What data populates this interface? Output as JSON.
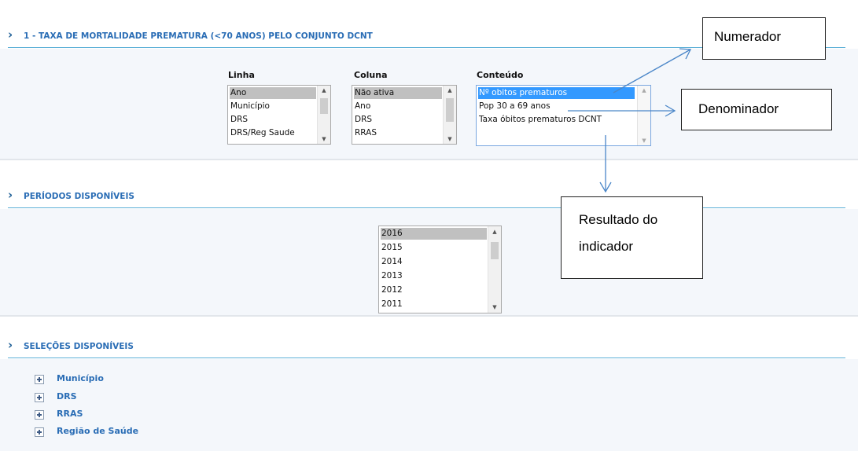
{
  "sections": {
    "taxa": {
      "title": "1 - TAXA DE MORTALIDADE PREMATURA (<70 ANOS) PELO CONJUNTO DCNT"
    },
    "periodos": {
      "title": "PERÍODOS DISPONÍVEIS"
    },
    "selecoes": {
      "title": "SELEÇÕES DISPONÍVEIS"
    }
  },
  "linha": {
    "label": "Linha",
    "items": [
      "Ano",
      "Município",
      "DRS",
      "DRS/Reg Saude"
    ],
    "selected": "Ano"
  },
  "coluna": {
    "label": "Coluna",
    "items": [
      "Não ativa",
      "Ano",
      "DRS",
      "RRAS"
    ],
    "selected": "Não ativa"
  },
  "conteudo": {
    "label": "Conteúdo",
    "items": [
      "Nº obitos prematuros",
      "Pop 30 a 69 anos",
      "Taxa óbitos prematuros DCNT"
    ],
    "selected": "Nº obitos prematuros"
  },
  "periodos_list": {
    "items": [
      "2016",
      "2015",
      "2014",
      "2013",
      "2012",
      "2011"
    ],
    "selected": "2016"
  },
  "selecoes_tree": {
    "items": [
      "Município",
      "DRS",
      "RRAS",
      "Região de Saúde"
    ]
  },
  "callouts": {
    "numerador": "Numerador",
    "denominador": "Denominador",
    "resultado_line1": "Resultado do",
    "resultado_line2": "indicador"
  },
  "colors": {
    "accent": "#2a6db5",
    "rule": "#5aaed6",
    "selection_blue": "#3399ff",
    "selection_grey": "#c0c0c0",
    "arrow": "#4a86c8"
  },
  "icons": {
    "section_chevron": "chevron-right-icon",
    "tree_expand": "plus-box-icon",
    "scroll_up": "arrow-up-icon",
    "scroll_down": "arrow-down-icon"
  }
}
